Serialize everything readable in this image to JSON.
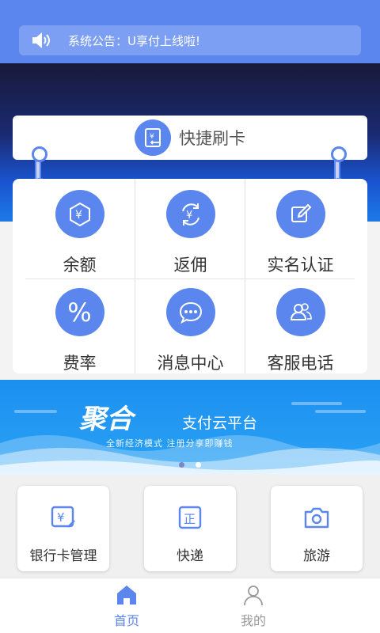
{
  "notice": {
    "icon": "speaker-icon",
    "text": "系统公告：U享付上线啦!"
  },
  "quick_swipe": {
    "icon": "card-swipe-icon",
    "label": "快捷刷卡"
  },
  "grid_items": [
    {
      "label": "余额",
      "icon": "yuan-balance-icon"
    },
    {
      "label": "返佣",
      "icon": "yuan-refresh-icon"
    },
    {
      "label": "实名认证",
      "icon": "edit-icon"
    },
    {
      "label": "费率",
      "icon": "percent-icon"
    },
    {
      "label": "消息中心",
      "icon": "chat-bubble-icon"
    },
    {
      "label": "客服电话",
      "icon": "people-icon"
    }
  ],
  "banner": {
    "logo": "聚合",
    "title": "支付云平台",
    "subtitle": "全新经济模式 注册分享即赚钱",
    "active_dot": 2
  },
  "services": [
    {
      "label": "银行卡管理",
      "icon": "bank-card-icon"
    },
    {
      "label": "快递",
      "icon": "express-icon"
    },
    {
      "label": "旅游",
      "icon": "camera-icon"
    }
  ],
  "tabs": [
    {
      "label": "首页",
      "icon": "home-icon",
      "active": true
    },
    {
      "label": "我的",
      "icon": "user-icon",
      "active": false
    }
  ],
  "colors": {
    "primary": "#5b86ee",
    "tab_active": "#5b86ee",
    "tab_inactive": "#999999"
  }
}
